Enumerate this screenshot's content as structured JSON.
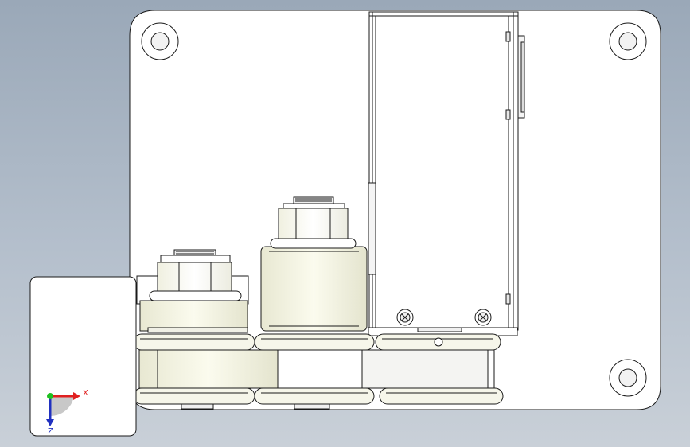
{
  "viewport": {
    "background_top": "#9aa8b8",
    "background_bottom": "#c9d0d8",
    "part_fill": "#ffffff",
    "roller_fill": "#f4f4e4",
    "edge_color": "#1a1a1a"
  },
  "triad": {
    "x_label": "X",
    "z_label": "Z",
    "x_color": "#e02020",
    "y_color": "#20c020",
    "z_color": "#2030c0"
  }
}
